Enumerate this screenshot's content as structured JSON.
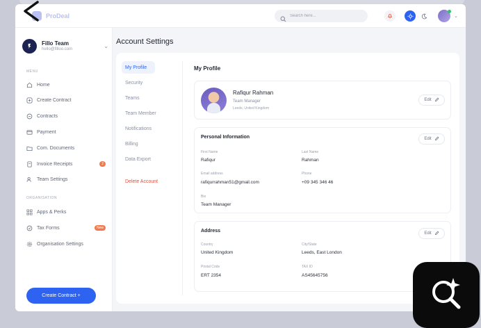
{
  "brand": {
    "name": "ProDeal"
  },
  "search": {
    "placeholder": "Search here..."
  },
  "team": {
    "name": "Fillo Team",
    "email": "hello@filloo.com"
  },
  "sidebar": {
    "menu_label": "MENU",
    "items": [
      {
        "label": "Home",
        "icon": "home-icon"
      },
      {
        "label": "Create Contract",
        "icon": "plus-circle-icon"
      },
      {
        "label": "Contracts",
        "icon": "contracts-icon"
      },
      {
        "label": "Payment",
        "icon": "card-icon"
      },
      {
        "label": "Com. Documents",
        "icon": "folder-icon"
      },
      {
        "label": "Invoice Receipts",
        "icon": "receipt-icon",
        "badge": "2"
      },
      {
        "label": "Team Settings",
        "icon": "users-icon"
      }
    ],
    "org_label": "ORGANISATION",
    "org_items": [
      {
        "label": "Apps & Perks",
        "icon": "grid-icon"
      },
      {
        "label": "Tax Forms",
        "icon": "tax-icon",
        "badge": "New"
      },
      {
        "label": "Organisation Settings",
        "icon": "gear-icon"
      }
    ],
    "create_button": "Create Contract +"
  },
  "page": {
    "title": "Account Settings"
  },
  "subnav": {
    "items": [
      "My Profile",
      "Security",
      "Teams",
      "Team Member",
      "Notifications",
      "Billing",
      "Data Export"
    ],
    "active": "My Profile",
    "delete": "Delete Account"
  },
  "profile": {
    "section_title": "My Profile",
    "name": "Rafiqur Rahman",
    "role": "Team Manager",
    "location": "Leeds, United Kingdom",
    "edit_label": "Edit"
  },
  "personal": {
    "title": "Personal Information",
    "edit_label": "Edit",
    "first_name_label": "First Name",
    "first_name": "Rafiqur",
    "last_name_label": "Last Name",
    "last_name": "Rahman",
    "email_label": "Email address",
    "email": "rafiqurrahman51@gmail.com",
    "phone_label": "Phone",
    "phone": "+09 345 346 46",
    "bio_label": "Bio",
    "bio": "Team Manager"
  },
  "address": {
    "title": "Address",
    "edit_label": "Edit",
    "country_label": "Country",
    "country": "United Kingdom",
    "city_label": "City/State",
    "city": "Leeds, East London",
    "postal_label": "Postal Code",
    "postal": "ERT 2354",
    "tax_label": "TAX ID",
    "tax": "AS45645756"
  },
  "colors": {
    "accent": "#2d63f0",
    "danger": "#e2503e",
    "badge": "#f07a4b"
  }
}
